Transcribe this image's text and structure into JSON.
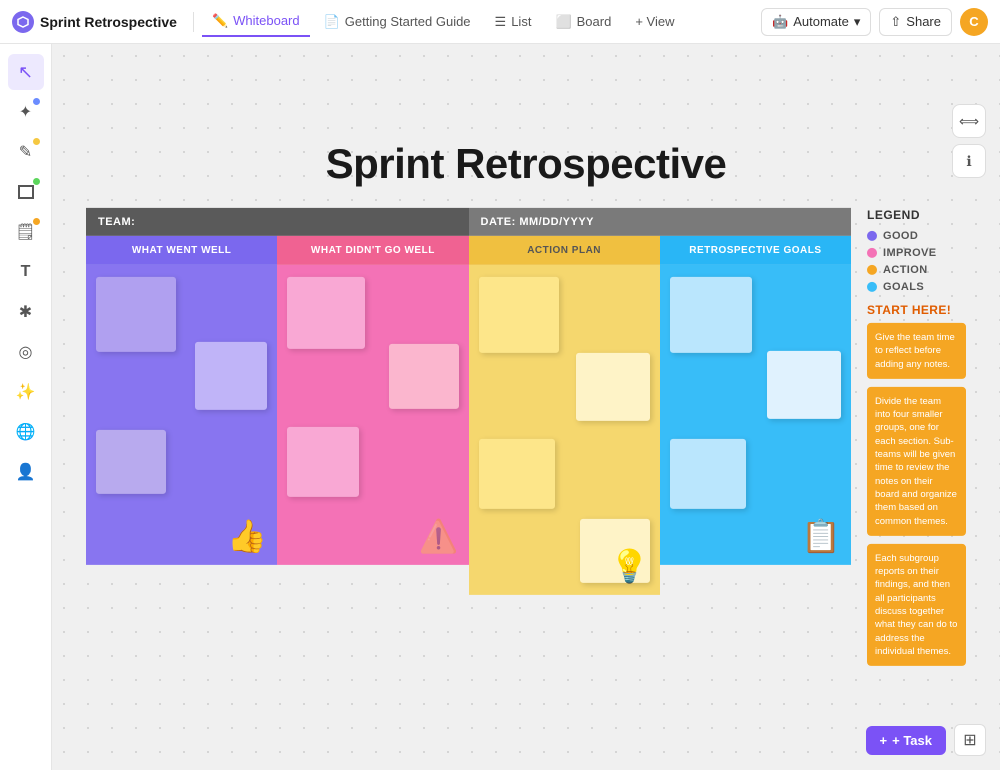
{
  "app": {
    "logo_icon": "⬡",
    "project_title": "Sprint Retrospective"
  },
  "nav": {
    "tabs": [
      {
        "id": "whiteboard",
        "label": "Whiteboard",
        "icon": "✏️",
        "active": true
      },
      {
        "id": "getting-started",
        "label": "Getting Started Guide",
        "icon": "📄",
        "active": false
      },
      {
        "id": "list",
        "label": "List",
        "icon": "☰",
        "active": false
      },
      {
        "id": "board",
        "label": "Board",
        "icon": "⬜",
        "active": false
      },
      {
        "id": "view",
        "label": "+ View",
        "icon": "",
        "active": false
      }
    ],
    "automate_label": "Automate",
    "share_label": "Share"
  },
  "toolbar": {
    "tools": [
      {
        "id": "cursor",
        "icon": "↖",
        "active": true,
        "dot": null
      },
      {
        "id": "magic",
        "icon": "✦",
        "active": false,
        "dot": "blue"
      },
      {
        "id": "pen",
        "icon": "✏️",
        "active": false,
        "dot": "yellow"
      },
      {
        "id": "shapes",
        "icon": "⬜",
        "active": false,
        "dot": "green"
      },
      {
        "id": "sticky",
        "icon": "🗒",
        "active": false,
        "dot": "orange"
      },
      {
        "id": "text",
        "icon": "T",
        "active": false,
        "dot": null
      },
      {
        "id": "line",
        "icon": "✱",
        "active": false,
        "dot": null
      },
      {
        "id": "network",
        "icon": "◎",
        "active": false,
        "dot": null
      },
      {
        "id": "sparkle",
        "icon": "✨",
        "active": false,
        "dot": null
      },
      {
        "id": "globe",
        "icon": "🌐",
        "active": false,
        "dot": null
      },
      {
        "id": "person",
        "icon": "👤",
        "active": false,
        "dot": null
      }
    ]
  },
  "whiteboard": {
    "title": "Sprint Retrospective",
    "team_label": "TEAM:",
    "date_label": "DATE: MM/DD/YYYY",
    "columns": [
      {
        "id": "went-well",
        "header": "WHAT WENT WELL",
        "header_class": "col-went-well",
        "body_class": "col-went-well-body"
      },
      {
        "id": "didnt-go",
        "header": "WHAT DIDN'T GO WELL",
        "header_class": "col-didnt-go",
        "body_class": "col-didnt-go-body"
      },
      {
        "id": "action",
        "header": "ACTION PLAN",
        "header_class": "col-action",
        "body_class": "col-action-body"
      },
      {
        "id": "goals",
        "header": "RETROSPECTIVE GOALS",
        "header_class": "col-goals",
        "body_class": "col-goals-body"
      }
    ]
  },
  "legend": {
    "title": "LEGEND",
    "items": [
      {
        "color": "#7b68ee",
        "label": "GOOD"
      },
      {
        "color": "#f472b6",
        "label": "IMPROVE"
      },
      {
        "color": "#f5a623",
        "label": "ACTION"
      },
      {
        "color": "#38bdf8",
        "label": "GOALS"
      }
    ],
    "start_label": "START HERE!",
    "cards": [
      "Give the team time to reflect before adding any notes.",
      "Divide the team into four smaller groups, one for each section. Sub-teams will be given time to review the notes on their board and organize them based on common themes.",
      "Each subgroup reports on their findings, and then all participants discuss together what they can do to address the individual themes."
    ]
  },
  "bottom_bar": {
    "task_label": "+ Task",
    "grid_icon": "⊞"
  }
}
